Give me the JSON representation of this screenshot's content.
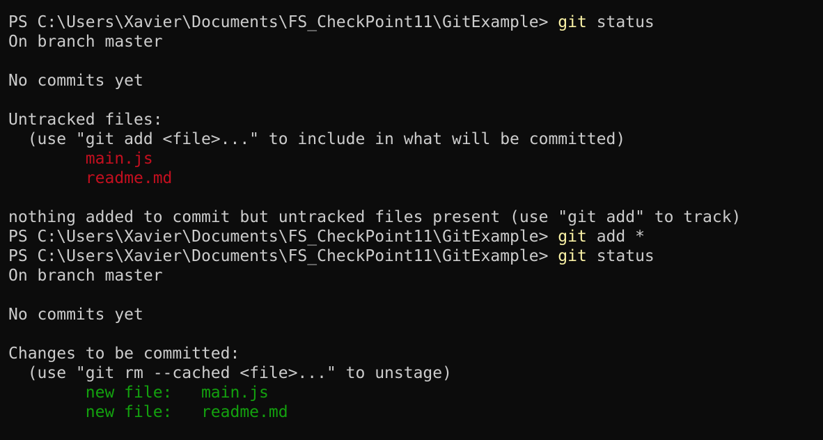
{
  "colors": {
    "background": "#0c0c0c",
    "foreground": "#cccccc",
    "command": "#f9f1a5",
    "untracked": "#c50f1f",
    "staged": "#13a10e"
  },
  "lines": [
    [
      {
        "t": "PS C:\\Users\\Xavier\\Documents\\FS_CheckPoint11\\GitExample> ",
        "c": "default"
      },
      {
        "t": "git",
        "c": "cmd"
      },
      {
        "t": " status",
        "c": "default"
      }
    ],
    [
      {
        "t": "On branch master",
        "c": "default"
      }
    ],
    [],
    [
      {
        "t": "No commits yet",
        "c": "default"
      }
    ],
    [],
    [
      {
        "t": "Untracked files:",
        "c": "default"
      }
    ],
    [
      {
        "t": "  (use \"git add <file>...\" to include in what will be committed)",
        "c": "default"
      }
    ],
    [
      {
        "t": "        main.js",
        "c": "red"
      }
    ],
    [
      {
        "t": "        readme.md",
        "c": "red"
      }
    ],
    [],
    [
      {
        "t": "nothing added to commit but untracked files present (use \"git add\" to track)",
        "c": "default"
      }
    ],
    [
      {
        "t": "PS C:\\Users\\Xavier\\Documents\\FS_CheckPoint11\\GitExample> ",
        "c": "default"
      },
      {
        "t": "git",
        "c": "cmd"
      },
      {
        "t": " add *",
        "c": "default"
      }
    ],
    [
      {
        "t": "PS C:\\Users\\Xavier\\Documents\\FS_CheckPoint11\\GitExample> ",
        "c": "default"
      },
      {
        "t": "git",
        "c": "cmd"
      },
      {
        "t": " status",
        "c": "default"
      }
    ],
    [
      {
        "t": "On branch master",
        "c": "default"
      }
    ],
    [],
    [
      {
        "t": "No commits yet",
        "c": "default"
      }
    ],
    [],
    [
      {
        "t": "Changes to be committed:",
        "c": "default"
      }
    ],
    [
      {
        "t": "  (use \"git rm --cached <file>...\" to unstage)",
        "c": "default"
      }
    ],
    [
      {
        "t": "        new file:   main.js",
        "c": "green"
      }
    ],
    [
      {
        "t": "        new file:   readme.md",
        "c": "green"
      }
    ]
  ]
}
